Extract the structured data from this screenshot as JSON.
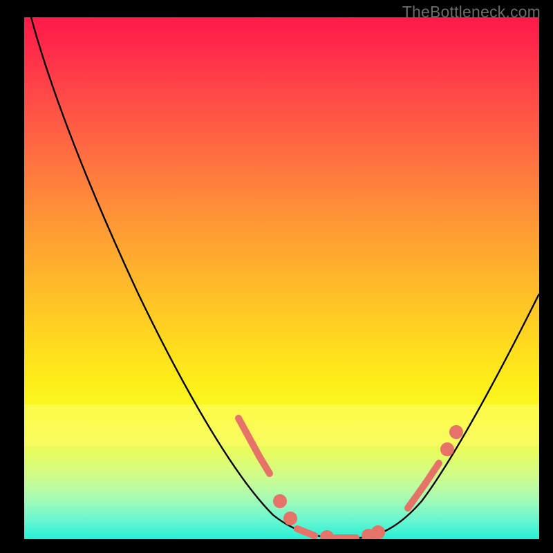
{
  "watermark": "TheBottleneck.com",
  "chart_data": {
    "type": "line",
    "title": "",
    "xlabel": "",
    "ylabel": "",
    "xlim": [
      0,
      100
    ],
    "ylim": [
      0,
      100
    ],
    "series": [
      {
        "name": "bottleneck-curve",
        "x": [
          0,
          5,
          10,
          15,
          20,
          25,
          30,
          35,
          40,
          45,
          50,
          53,
          56,
          59,
          62,
          65,
          68,
          72,
          76,
          80,
          84,
          88,
          92,
          96,
          100
        ],
        "y": [
          100,
          93,
          85,
          77,
          69,
          60,
          51,
          42,
          33,
          24,
          15,
          9,
          4,
          1,
          0,
          0,
          1,
          3,
          7,
          12,
          18,
          25,
          33,
          41,
          50
        ]
      }
    ],
    "markers": {
      "name": "highlight-points",
      "x": [
        40,
        42,
        44,
        46,
        50,
        53,
        55,
        57,
        59,
        61,
        63,
        65,
        67,
        71,
        73,
        75,
        77,
        79,
        81
      ],
      "y": [
        23,
        20,
        17,
        14,
        9,
        4,
        2,
        1,
        0,
        0,
        0,
        0,
        1,
        4,
        6,
        9,
        12,
        15,
        18
      ]
    },
    "gradient_bands": [
      {
        "pos": 0.0,
        "color": "#ff1a49"
      },
      {
        "pos": 0.5,
        "color": "#ffba28"
      },
      {
        "pos": 0.78,
        "color": "#f9fa23"
      },
      {
        "pos": 1.0,
        "color": "#27f0d6"
      }
    ]
  }
}
